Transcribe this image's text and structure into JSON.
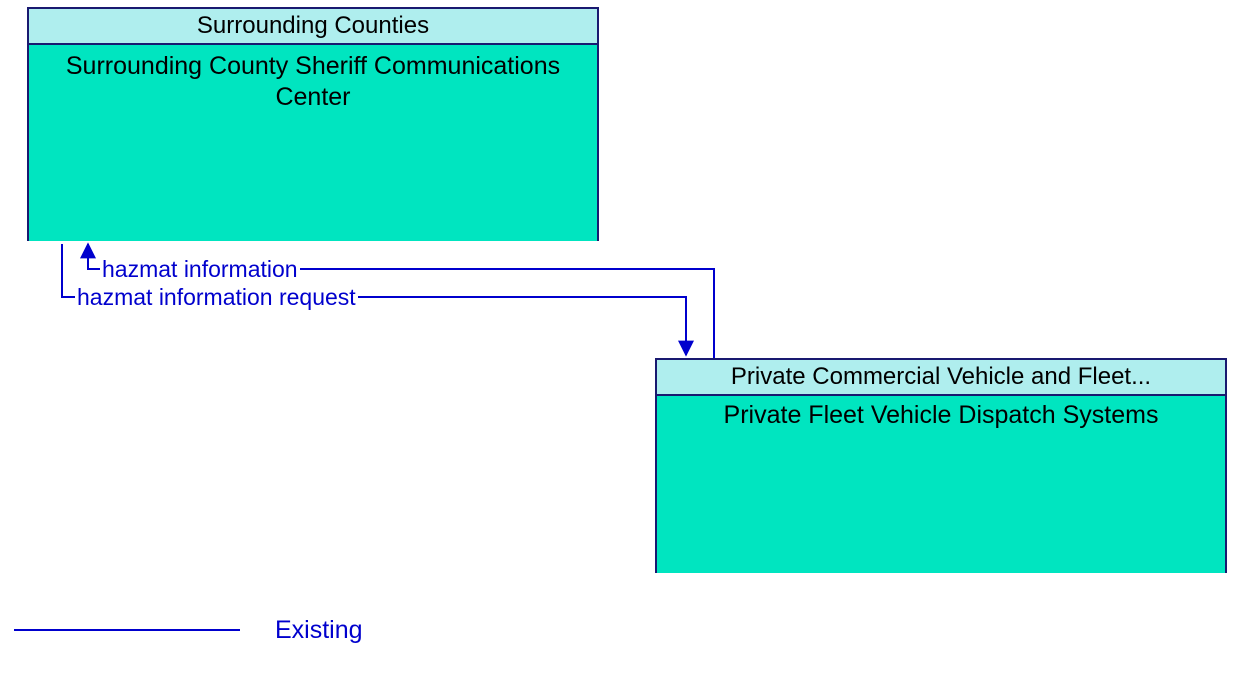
{
  "colors": {
    "border": "#191970",
    "header_bg": "#AFEEEE",
    "body_bg": "#00E5C0",
    "text_dark": "#000000",
    "flow": "#0000CD"
  },
  "boxes": {
    "left": {
      "header": "Surrounding Counties",
      "body": "Surrounding County Sheriff Communications Center"
    },
    "right": {
      "header": "Private Commercial Vehicle and Fleet...",
      "body": "Private Fleet Vehicle Dispatch Systems"
    }
  },
  "flows": {
    "top": "hazmat information",
    "bottom": "hazmat information request"
  },
  "legend": {
    "existing": "Existing"
  }
}
